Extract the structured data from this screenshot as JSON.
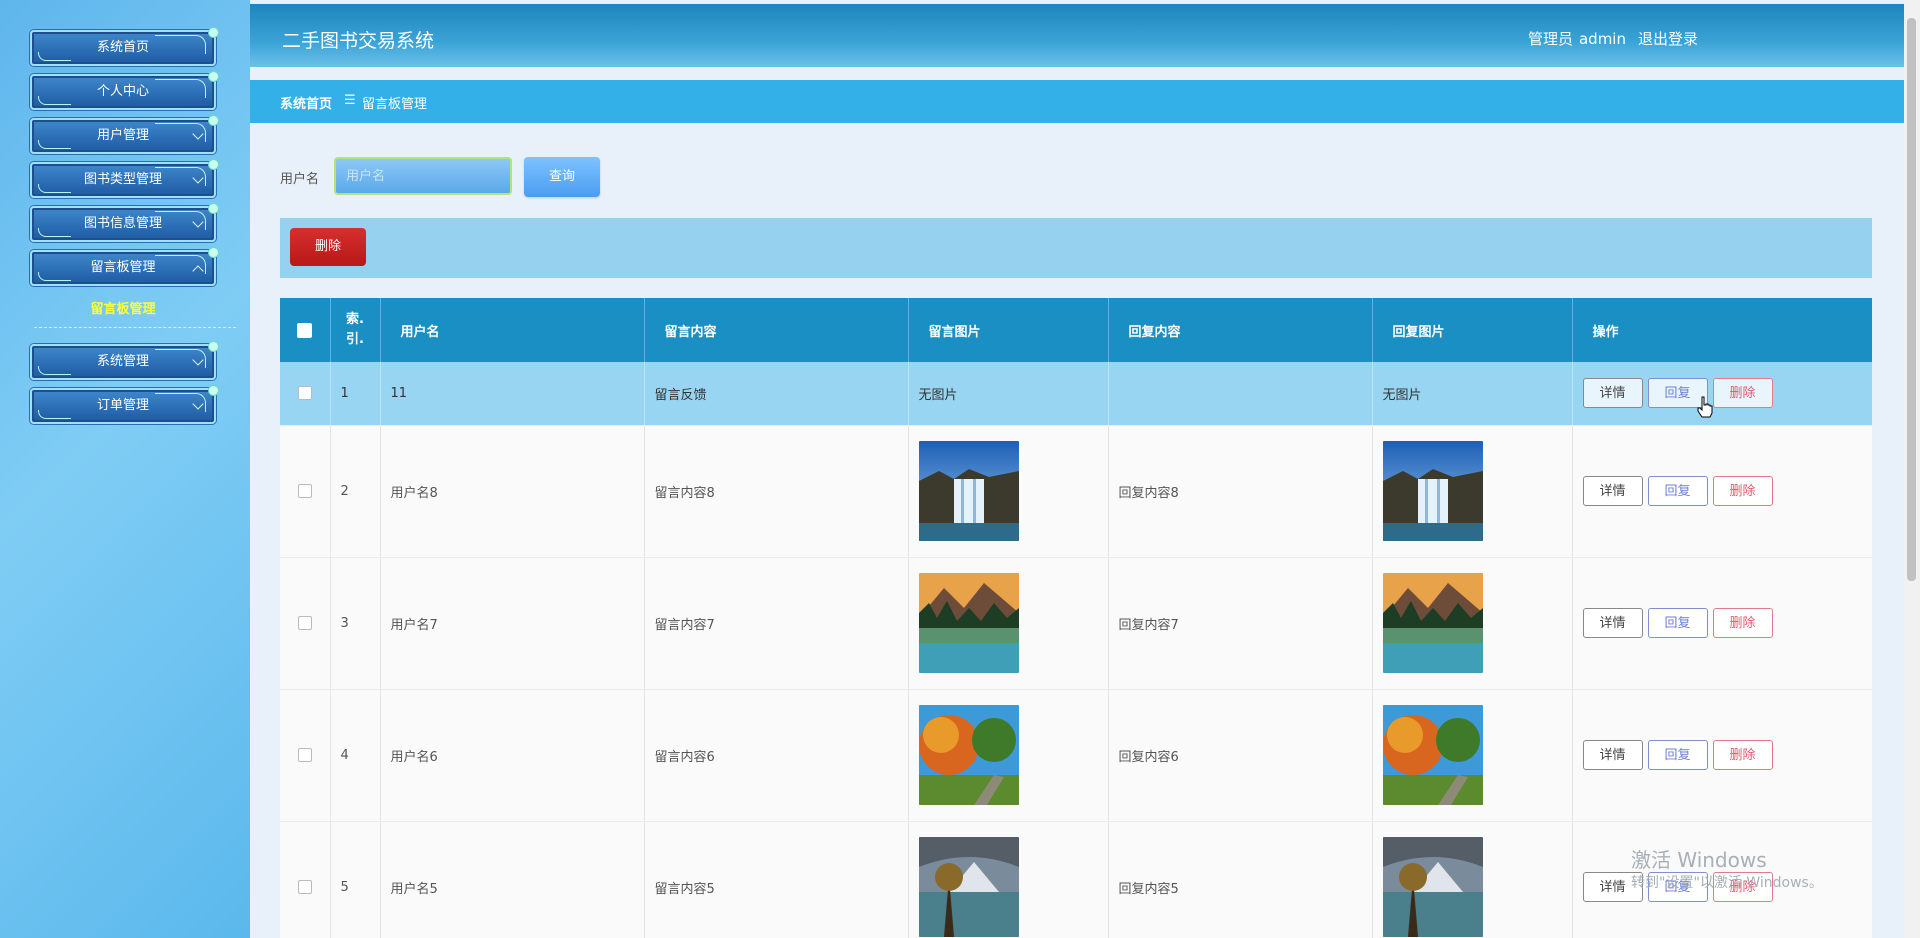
{
  "sidebar": {
    "menu": [
      "系统首页",
      "个人中心",
      "用户管理",
      "图书类型管理",
      "图书信息管理",
      "留言板管理"
    ],
    "active_sub": "留言板管理",
    "menu_bottom": [
      "系统管理",
      "订单管理"
    ]
  },
  "header": {
    "title": "二手图书交易系统",
    "admin_role": "管理员",
    "admin_name": "admin",
    "logout": "退出登录"
  },
  "breadcrumb": {
    "home": "系统首页",
    "separator": "☰",
    "current": "留言板管理"
  },
  "search": {
    "label": "用户名",
    "placeholder": "用户名",
    "button": "查询"
  },
  "toolbar": {
    "delete_label": "删除"
  },
  "table": {
    "columns": [
      "索引",
      "用户名",
      "留言内容",
      "留言图片",
      "回复内容",
      "回复图片",
      "操作"
    ],
    "index_header_line1": "索.",
    "index_header_line2": "引.",
    "no_image_text": "无图片",
    "actions": {
      "detail": "详情",
      "reply": "回复",
      "delete": "删除"
    },
    "rows": [
      {
        "index": "1",
        "username": "11",
        "message": "留言反馈",
        "message_image": "无图片",
        "reply": "",
        "reply_image": "无图片",
        "image_theme": "none"
      },
      {
        "index": "2",
        "username": "用户名8",
        "message": "留言内容8",
        "message_image": "image",
        "reply": "回复内容8",
        "reply_image": "image",
        "image_theme": "waterfall"
      },
      {
        "index": "3",
        "username": "用户名7",
        "message": "留言内容7",
        "message_image": "image",
        "reply": "回复内容7",
        "reply_image": "image",
        "image_theme": "lake"
      },
      {
        "index": "4",
        "username": "用户名6",
        "message": "留言内容6",
        "message_image": "image",
        "reply": "回复内容6",
        "reply_image": "image",
        "image_theme": "autumn"
      },
      {
        "index": "5",
        "username": "用户名5",
        "message": "留言内容5",
        "message_image": "image",
        "reply": "回复内容5",
        "reply_image": "image",
        "image_theme": "mountain"
      }
    ]
  },
  "watermark": {
    "line1": "激活 Windows",
    "line2": "转到\"设置\"以激活 Windows。"
  },
  "colors": {
    "header_bg": "#1f85bd",
    "breadcrumb_bg": "#33b0e8",
    "table_header": "#198fc4",
    "danger": "#c62020"
  }
}
